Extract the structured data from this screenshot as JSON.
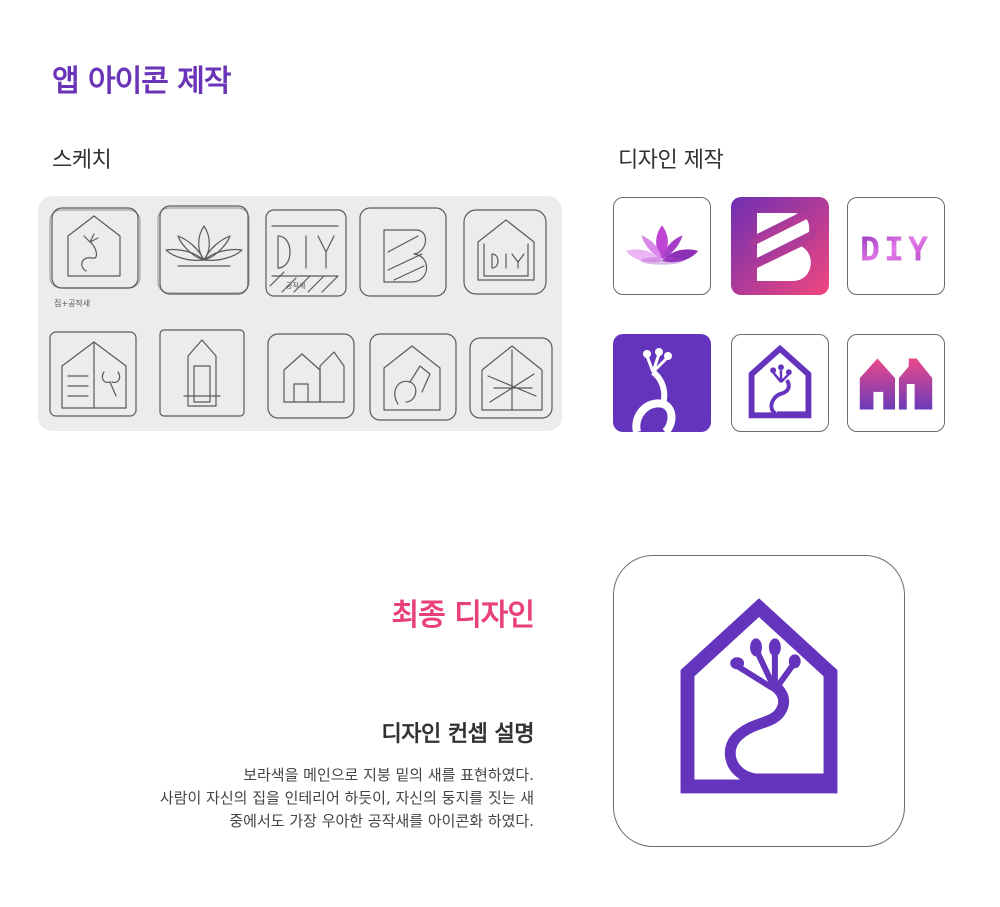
{
  "header": {
    "title": "앱 아이콘 제작"
  },
  "sketch": {
    "label": "스케치",
    "paper_diy_text": "DIY",
    "paper_note": "집+공작새",
    "paper_note2": "공작새"
  },
  "design": {
    "label": "디자인 제작",
    "icons": [
      {
        "name": "lotus",
        "colors": [
          "#c45cd8",
          "#e6a6f0"
        ]
      },
      {
        "name": "stripe-b",
        "colors": [
          "#7a2fb8",
          "#f0467e"
        ]
      },
      {
        "name": "diy-text",
        "text": "DIY",
        "colors": [
          "#a93fc9",
          "#e374e4"
        ]
      },
      {
        "name": "peacock",
        "colors": [
          "#6434bd"
        ]
      },
      {
        "name": "house-peacock-outline",
        "colors": [
          "#6434bd"
        ]
      },
      {
        "name": "houses-gradient",
        "colors": [
          "#e9498a",
          "#6b3bb8"
        ]
      }
    ]
  },
  "final": {
    "title": "최종 디자인",
    "concept_heading": "디자인 컨셉 설명",
    "concept_lines": [
      "보라색을 메인으로 지붕 밑의 새를 표현하였다.",
      "사람이 자신의 집을 인테리어 하듯이, 자신의 둥지를 짓는 새",
      "중에서도 가장 우아한 공작새를 아이콘화 하였다."
    ],
    "icon": {
      "name": "house-peacock",
      "color": "#6434bd"
    }
  }
}
